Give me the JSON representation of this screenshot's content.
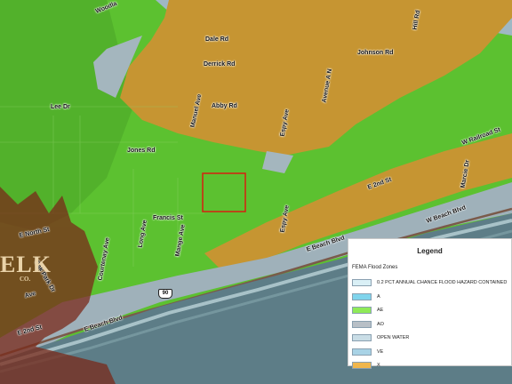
{
  "map": {
    "roads": {
      "woodland": "Woodla",
      "dale": "Dale Rd",
      "johnson": "Johnson Rd",
      "derrick": "Derrick Rd",
      "abby": "Abby Rd",
      "manuel": "Manuel Ave",
      "espy_north": "Espy Ave",
      "avenue_a": "Avenue A N",
      "hill": "Hill Rd",
      "lee": "Lee Dr",
      "jones": "Jones Rd",
      "railroad": "W Railroad St",
      "marcie": "Marcie Dr",
      "e2nd_mid": "E 2nd St",
      "beach_w": "W Beach Blvd",
      "e_beach_mid": "E Beach Blvd",
      "e_beach_low": "E Beach Blvd",
      "francis": "Francis St",
      "espy_south": "Espy Ave",
      "mange": "Mange Ave",
      "long": "Long Ave",
      "courtenay": "Courtenay Ave",
      "e_north": "E North St",
      "oak_park": "Oak Park Dr",
      "ave_frag": "Ave",
      "e2nd_low": "E 2nd St"
    },
    "highway_shield": "90",
    "overlay_text": "ELK",
    "overlay_subtext": "CO.",
    "colors": {
      "zone_x": "#c9952e",
      "zone_ae": "#6ad12f",
      "zone_ao": "#a9b7c0",
      "zone_ve": "#a9cde0",
      "parcel_outline": "#d61f10"
    }
  },
  "legend": {
    "title": "Legend",
    "group_label": "FEMA Flood Zones",
    "entries": [
      {
        "label": "0.2 PCT ANNUAL CHANCE FLOOD HAZARD CONTAINED",
        "color": "#daf0f6"
      },
      {
        "label": "A",
        "color": "#7fd4ec"
      },
      {
        "label": "AE",
        "color": "#8fea58"
      },
      {
        "label": "AO",
        "color": "#b8bfc6"
      },
      {
        "label": "OPEN WATER",
        "color": "#c9dde6"
      },
      {
        "label": "VE",
        "color": "#a9d3e6"
      },
      {
        "label": "X",
        "color": "#f0b64c"
      }
    ]
  }
}
